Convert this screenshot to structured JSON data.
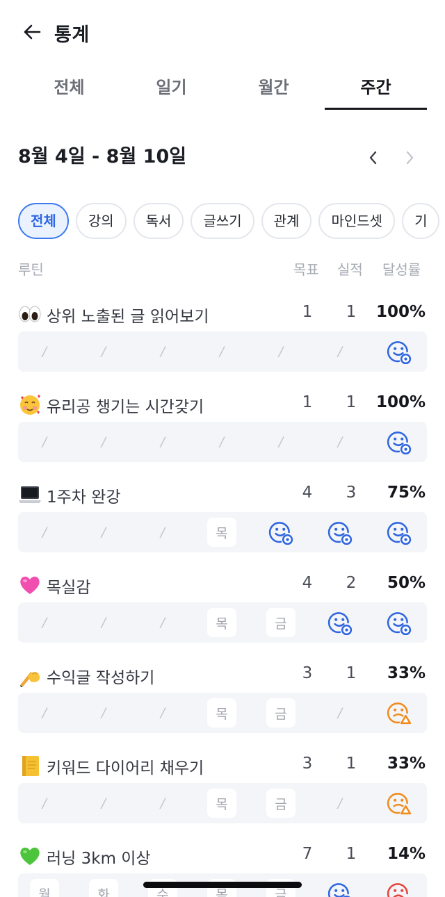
{
  "header": {
    "title": "통계"
  },
  "tabs": [
    {
      "label": "전체",
      "active": false
    },
    {
      "label": "일기",
      "active": false
    },
    {
      "label": "월간",
      "active": false
    },
    {
      "label": "주간",
      "active": true
    }
  ],
  "week": {
    "label": "8월 4일 - 8월 10일"
  },
  "chips": [
    {
      "label": "전체",
      "active": true
    },
    {
      "label": "강의",
      "active": false
    },
    {
      "label": "독서",
      "active": false
    },
    {
      "label": "글쓰기",
      "active": false
    },
    {
      "label": "관계",
      "active": false
    },
    {
      "label": "마인드셋",
      "active": false
    },
    {
      "label": "기",
      "active": false
    }
  ],
  "columns": {
    "routine": "루틴",
    "goal": "목표",
    "actual": "실적",
    "rate": "달성률"
  },
  "colors": {
    "accent": "#2d67e3",
    "success_icon": "#2f66e0",
    "warning_icon": "#f08c1e",
    "danger_icon": "#e5443c"
  },
  "routines": [
    {
      "emoji": "eyes",
      "name": "상위 노출된 글 읽어보기",
      "goal": "1",
      "actual": "1",
      "rate": "100%",
      "days": [
        {
          "t": "/"
        },
        {
          "t": "/"
        },
        {
          "t": "/"
        },
        {
          "t": "/"
        },
        {
          "t": "/"
        },
        {
          "t": "/"
        },
        {
          "icon": "smile-icon"
        }
      ]
    },
    {
      "emoji": "hearts-face",
      "name": "유리공 챙기는 시간갖기",
      "goal": "1",
      "actual": "1",
      "rate": "100%",
      "days": [
        {
          "t": "/"
        },
        {
          "t": "/"
        },
        {
          "t": "/"
        },
        {
          "t": "/"
        },
        {
          "t": "/"
        },
        {
          "t": "/"
        },
        {
          "icon": "smile-icon"
        }
      ]
    },
    {
      "emoji": "laptop",
      "name": "1주차 완강",
      "goal": "4",
      "actual": "3",
      "rate": "75%",
      "days": [
        {
          "t": "/"
        },
        {
          "t": "/"
        },
        {
          "t": "/"
        },
        {
          "d": "목"
        },
        {
          "icon": "smile-icon"
        },
        {
          "icon": "smile-icon"
        },
        {
          "icon": "smile-icon"
        }
      ]
    },
    {
      "emoji": "pink-heart",
      "name": "목실감",
      "goal": "4",
      "actual": "2",
      "rate": "50%",
      "days": [
        {
          "t": "/"
        },
        {
          "t": "/"
        },
        {
          "t": "/"
        },
        {
          "d": "목"
        },
        {
          "d": "금"
        },
        {
          "icon": "smile-icon"
        },
        {
          "icon": "smile-icon"
        }
      ]
    },
    {
      "emoji": "writing-hand",
      "name": "수익글 작성하기",
      "goal": "3",
      "actual": "1",
      "rate": "33%",
      "days": [
        {
          "t": "/"
        },
        {
          "t": "/"
        },
        {
          "t": "/"
        },
        {
          "d": "목"
        },
        {
          "d": "금"
        },
        {
          "t": "/"
        },
        {
          "icon": "worried-icon"
        }
      ]
    },
    {
      "emoji": "notebook",
      "name": "키워드 다이어리 채우기",
      "goal": "3",
      "actual": "1",
      "rate": "33%",
      "days": [
        {
          "t": "/"
        },
        {
          "t": "/"
        },
        {
          "t": "/"
        },
        {
          "d": "목"
        },
        {
          "d": "금"
        },
        {
          "t": "/"
        },
        {
          "icon": "worried-icon"
        }
      ]
    },
    {
      "emoji": "green-heart",
      "name": "러닝 3km 이상",
      "goal": "7",
      "actual": "1",
      "rate": "14%",
      "days": [
        {
          "d": "월"
        },
        {
          "d": "화"
        },
        {
          "d": "수"
        },
        {
          "d": "목"
        },
        {
          "d": "금"
        },
        {
          "icon": "smile-icon"
        },
        {
          "icon": "sad-icon"
        }
      ]
    }
  ]
}
